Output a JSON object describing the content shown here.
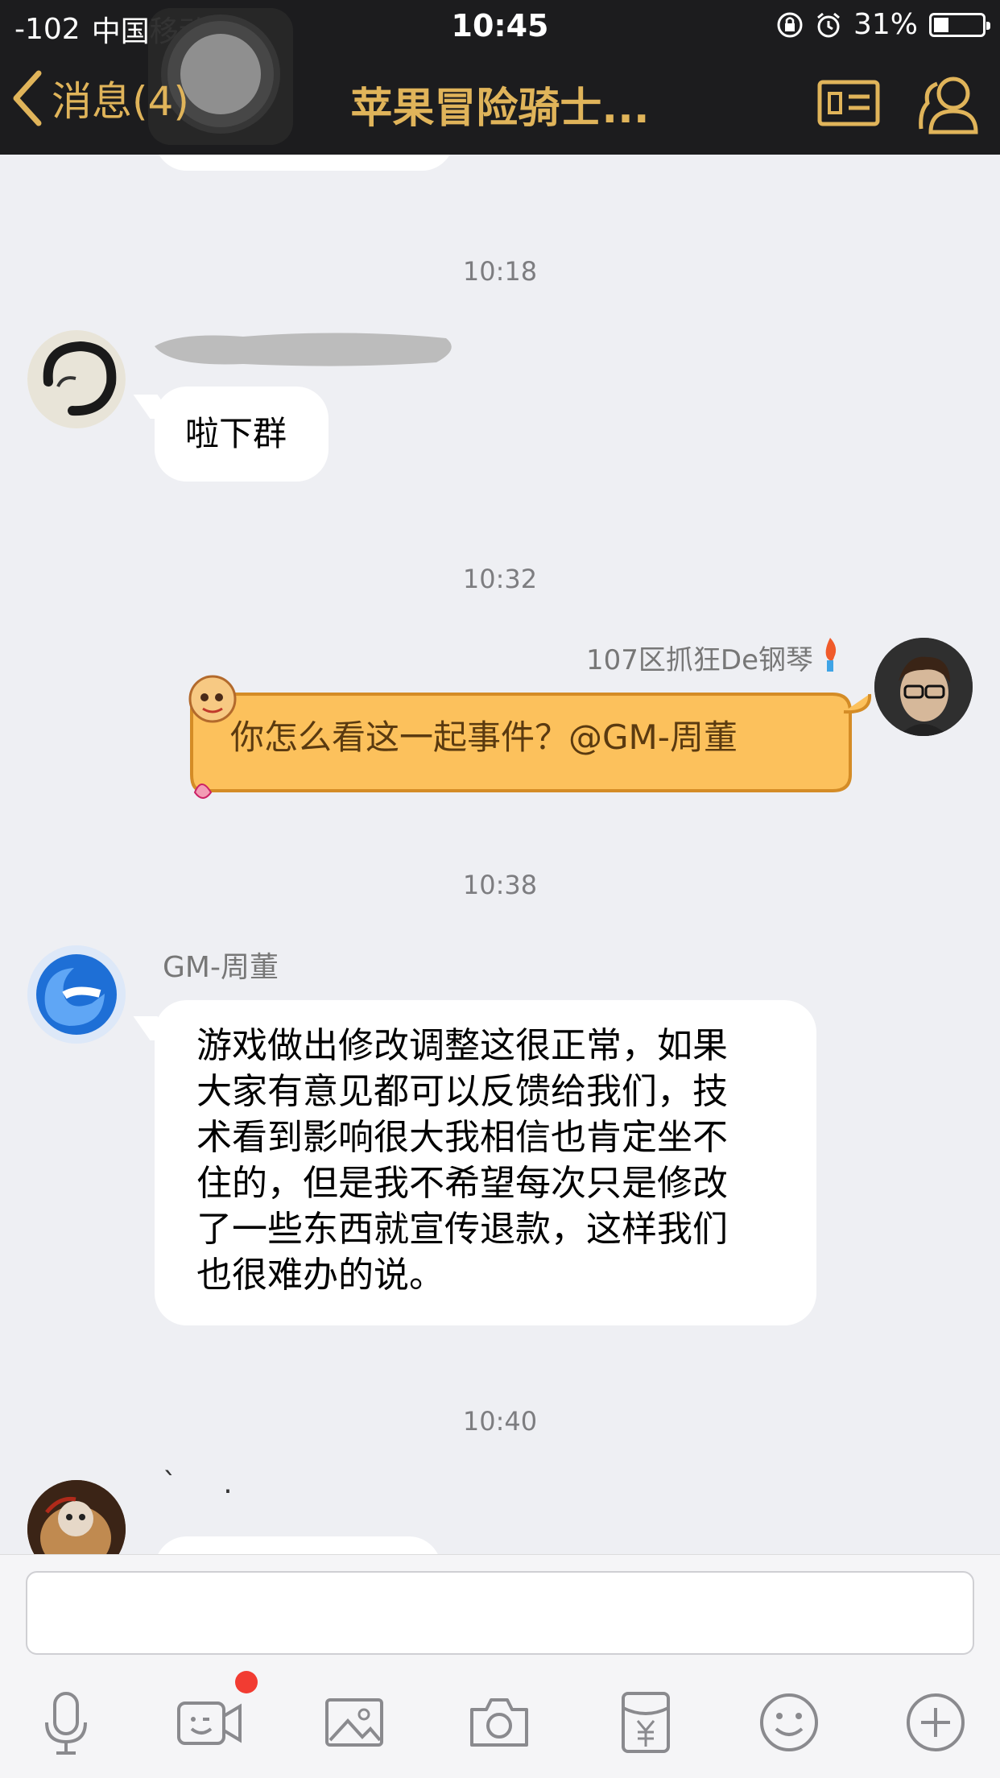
{
  "status_bar": {
    "signal": "-102",
    "carrier": "中国移动",
    "time": "10:45",
    "battery": "31%",
    "battery_level": 0.31
  },
  "nav": {
    "back_label": "消息(4)",
    "title": "苹果冒险骑士..."
  },
  "messages": {
    "t1": "10:18",
    "m1_text": "啦下群",
    "t2": "10:32",
    "m2_sender": "107区抓狂De钢琴",
    "m2_text": "你怎么看这一起事件？@GM-周董",
    "t3": "10:38",
    "m3_sender": "GM-周董",
    "m3_lines": [
      "游戏做出修改调整这很正常，如果",
      "大家有意见都可以反馈给我们，技",
      "术看到影响很大我相信也肯定坐不",
      "住的，但是我不希望每次只是修改",
      "了一些东西就宣传退款，这样我们",
      "也很难办的说。"
    ],
    "t4": "10:40",
    "m4_sender": "`     ."
  },
  "colors": {
    "header_bg": "#1c1c1e",
    "accent_gold": "#e0b45a",
    "chat_bg": "#eeeff3",
    "bubble_yellow": "#fcc15c",
    "badge_red": "#f23c32"
  },
  "icons": [
    "back-chevron-icon",
    "profile-card-icon",
    "group-members-icon",
    "microphone-icon",
    "video-call-icon",
    "image-icon",
    "camera-icon",
    "red-packet-icon",
    "emoji-icon",
    "plus-icon"
  ]
}
